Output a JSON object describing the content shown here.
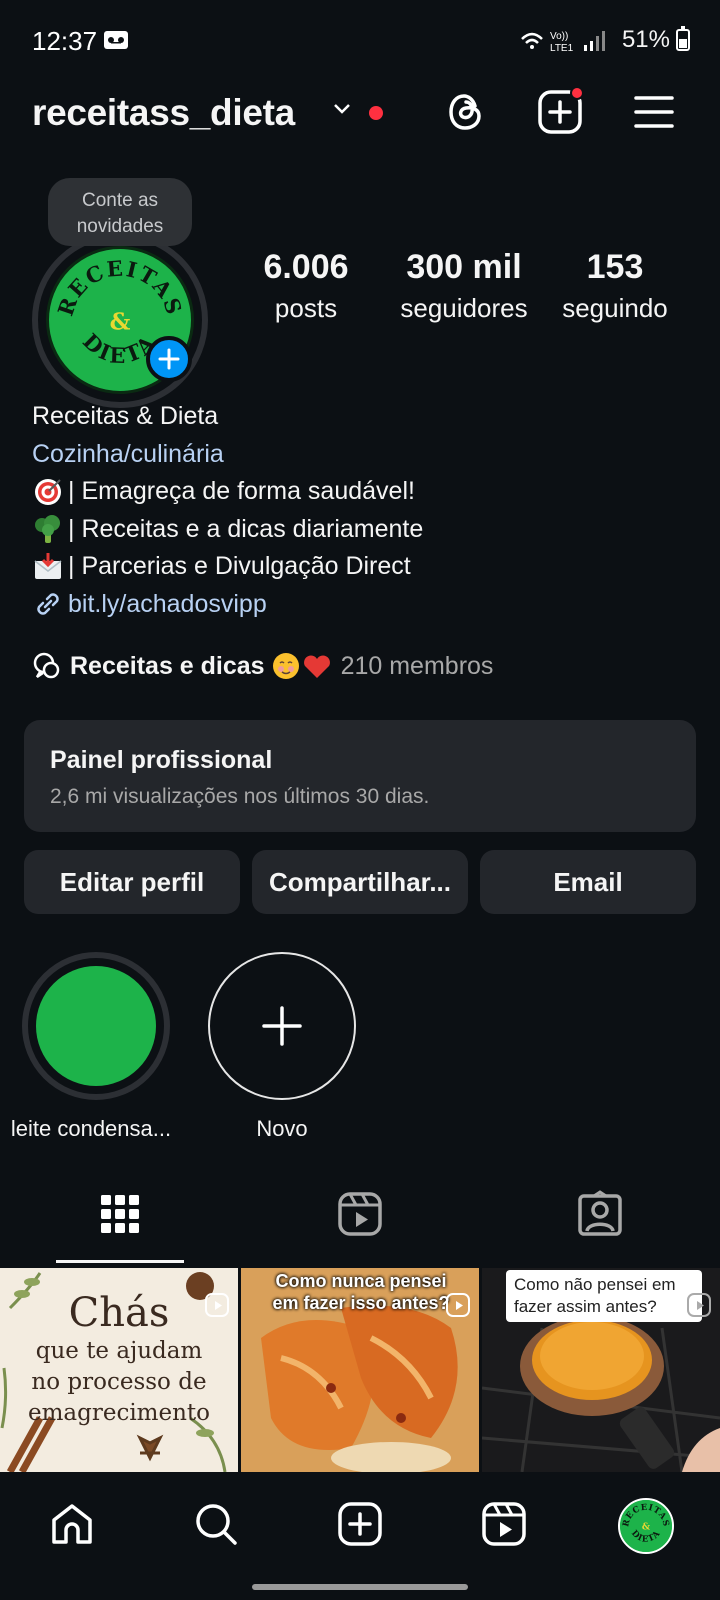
{
  "status_bar": {
    "time": "12:37",
    "battery": "51%",
    "network": "LTE1"
  },
  "header": {
    "username": "receitass_dieta",
    "icons": [
      "chevron-down-icon",
      "threads-icon",
      "create-icon",
      "menu-icon"
    ]
  },
  "profile": {
    "note_bubble": [
      "Conte as",
      "novidades"
    ],
    "avatar_text": [
      "RECEITAS",
      "&",
      "DIETA"
    ],
    "stats": [
      {
        "value": "6.006",
        "label": "posts"
      },
      {
        "value": "300 mil",
        "label": "seguidores"
      },
      {
        "value": "153",
        "label": "seguindo"
      }
    ],
    "name": "Receitas & Dieta",
    "category": "Cozinha/culinária",
    "bio_lines": [
      {
        "emoji": "target-emoji",
        "text": "| Emagreça de forma saudável!"
      },
      {
        "emoji": "broccoli-emoji",
        "text": "| Receitas e a dicas diariamente"
      },
      {
        "emoji": "inbox-emoji",
        "text": "| Parcerias e Divulgação Direct"
      }
    ],
    "link": "bit.ly/achadosvipp",
    "channel": {
      "title": "Receitas e dicas",
      "emoji": "smiling-face-with-hearts-emoji red-heart-emoji",
      "members": "210 membros"
    }
  },
  "dashboard": {
    "title": "Painel profissional",
    "subtitle": "2,6 mi visualizações nos últimos 30 dias."
  },
  "buttons": {
    "edit": "Editar perfil",
    "share": "Compartilhar...",
    "email": "Email"
  },
  "highlights": [
    {
      "label": "leite condensa..."
    },
    {
      "label": "Novo"
    }
  ],
  "tabs": [
    "grid-icon",
    "reels-icon",
    "tagged-icon"
  ],
  "posts": [
    {
      "title": "Chás",
      "lines": [
        "que te ajudam",
        "no processo de",
        "emagrecimento"
      ]
    },
    {
      "caption": "Como nunca pensei em fazer isso antes?"
    },
    {
      "caption": "Como não pensei em fazer assim antes?"
    }
  ],
  "colors": {
    "background": "#0c1014",
    "accent_blue": "#0095f6",
    "notification_red": "#ff3040",
    "card": "#23262b",
    "avatar_green": "#1db34a"
  }
}
